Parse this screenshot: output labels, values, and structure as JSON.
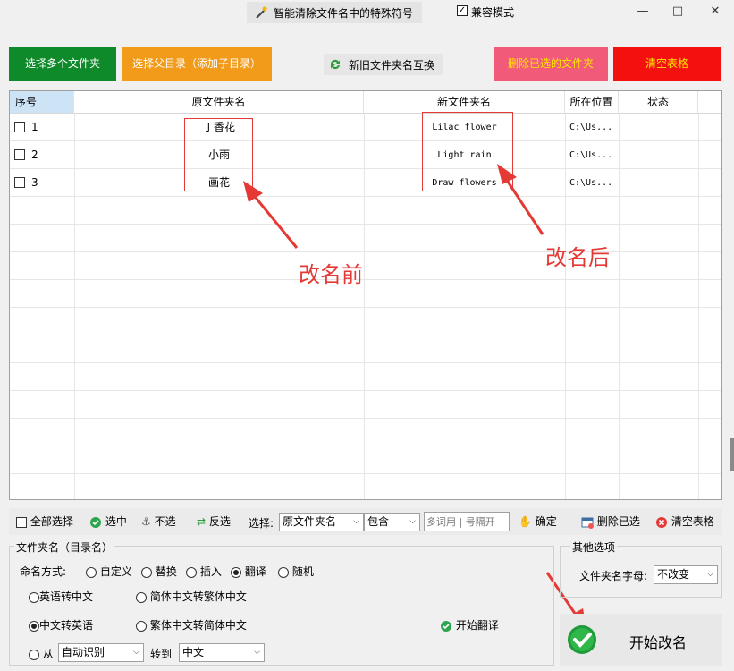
{
  "titlebar": {
    "title": "智能清除文件名中的特殊符号",
    "compat_label": "兼容模式",
    "minimize": "—",
    "maximize": "□",
    "close": "✕"
  },
  "top_buttons": {
    "select_multi": "选择多个文件夹",
    "select_parent": "选择父目录（添加子目录）",
    "swap": "新旧文件夹名互换",
    "delete_selected": "删除已选的文件夹",
    "clear_table": "清空表格"
  },
  "table": {
    "headers": [
      "序号",
      "原文件夹名",
      "新文件夹名",
      "所在位置",
      "状态"
    ],
    "rows": [
      {
        "index": "1",
        "original": "丁香花",
        "new": "Lilac flower",
        "location": "C:\\Us...",
        "status": ""
      },
      {
        "index": "2",
        "original": "小雨",
        "new": "Light rain",
        "location": "C:\\Us...",
        "status": ""
      },
      {
        "index": "3",
        "original": "画花",
        "new": "Draw flowers",
        "location": "C:\\Us...",
        "status": ""
      }
    ]
  },
  "annotations": {
    "before": "改名前",
    "after": "改名后"
  },
  "toolbar": {
    "select_all": "全部选择",
    "select": "选中",
    "deselect": "不选",
    "invert": "反选",
    "choose_label": "选择:",
    "field_value": "原文件夹名",
    "match_value": "包含",
    "keyword_placeholder": "多词用 | 号隔开",
    "confirm": "确定",
    "delete_selected": "删除已选",
    "clear_table": "清空表格"
  },
  "naming": {
    "group_title": "文件夹名（目录名）",
    "mode_label": "命名方式:",
    "modes": [
      "自定义",
      "替换",
      "插入",
      "翻译",
      "随机"
    ],
    "mode_selected": "翻译",
    "opt_en_to_zh": "英语转中文",
    "opt_simp_to_trad": "简体中文转繁体中文",
    "opt_zh_to_en": "中文转英语",
    "opt_trad_to_simp": "繁体中文转简体中文",
    "opt_from": "从",
    "from_value": "自动识别",
    "to_label": "转到",
    "to_value": "中文",
    "start_translate": "开始翻译"
  },
  "other": {
    "group_title": "其他选项",
    "case_label": "文件夹名字母:",
    "case_value": "不改变"
  },
  "start_rename": "开始改名"
}
